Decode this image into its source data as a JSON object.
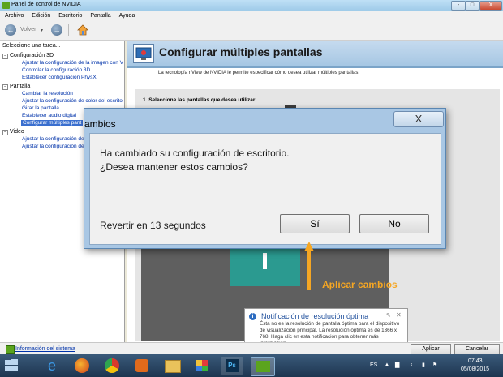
{
  "window": {
    "title": "Panel de control de NVIDIA",
    "buttons": [
      "-",
      "□",
      "X"
    ]
  },
  "menu": [
    "Archivo",
    "Edición",
    "Escritorio",
    "Pantalla",
    "Ayuda"
  ],
  "toolbar": {
    "back_label": "Volver"
  },
  "left_panel": {
    "header": "Seleccione una tarea...",
    "tree": [
      {
        "category": "Configuración 3D",
        "items": [
          "Ajustar la configuración de la imagen con V",
          "Controlar la configuración 3D",
          "Establecer configuración PhysX"
        ]
      },
      {
        "category": "Pantalla",
        "items": [
          "Cambiar la resolución",
          "Ajustar la configuración de color del escrito",
          "Girar la pantalla",
          "Establecer audio digital",
          "Configurar múltiples pant"
        ]
      },
      {
        "category": "Video",
        "items": [
          "Ajustar la configuración de",
          "Ajustar la configuración de"
        ]
      }
    ],
    "selected": "Configurar múltiples pant"
  },
  "main": {
    "title": "Configurar múltiples pantallas",
    "subtitle": "La tecnología nView de NVIDIA le permite especificar cómo desea utilizar múltiples pantallas.",
    "step1": "1. Seleccione las pantallas que desea utilizar."
  },
  "dialog": {
    "title": "ambios",
    "close": "X",
    "message_line1": "Ha cambiado su configuración de escritorio.",
    "message_line2": "¿Desea mantener estos cambios?",
    "countdown": "Revertir en 13 segundos",
    "yes": "Sí",
    "no": "No"
  },
  "annotation": {
    "label": "Aplicar cambios",
    "color": "#f5a623"
  },
  "notification": {
    "title": "Notificación de resolución óptima",
    "body": "Ésta no es la resolución de pantalla óptima para el dispositivo de visualización principal. La resolución óptima es de 1366 x 768. Haga clic en esta notificación para obtener más información."
  },
  "bottom": {
    "system_info": "Información del sistema",
    "apply": "Aplicar",
    "cancel": "Cancelar"
  },
  "taskbar": {
    "language": "ES",
    "time": "07:43",
    "date": "05/08/2015"
  }
}
